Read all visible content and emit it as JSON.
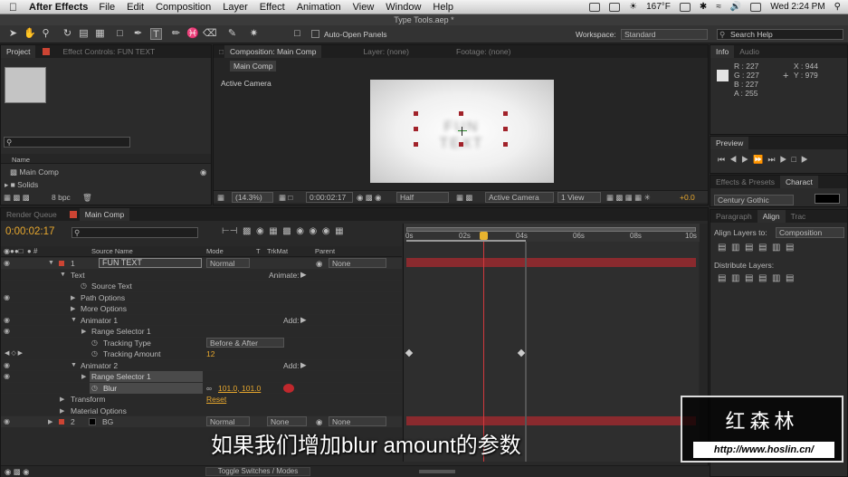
{
  "menubar": {
    "app": "After Effects",
    "items": [
      "File",
      "Edit",
      "Composition",
      "Layer",
      "Effect",
      "Animation",
      "View",
      "Window",
      "Help"
    ],
    "temp": "167°F",
    "time": "Wed 2:24 PM"
  },
  "window_title": "Type Tools.aep *",
  "toolbar": {
    "auto_open": "Auto-Open Panels",
    "workspace_label": "Workspace:",
    "workspace_value": "Standard",
    "search": "Search Help"
  },
  "project": {
    "tabs": [
      "Project",
      "Effect Controls: FUN TEXT"
    ],
    "col_name": "Name",
    "items": [
      "Main Comp",
      "Solids"
    ],
    "bpc": "8 bpc"
  },
  "comp": {
    "tabs": [
      "Composition: Main Comp",
      "Layer: (none)",
      "Footage: (none)"
    ],
    "subtab": "Main Comp",
    "camera": "Active Camera",
    "zoom": "(14.3%)",
    "timecode": "0:00:02:17",
    "resolution": "Half",
    "view_camera": "Active Camera",
    "views": "1 View",
    "exposure": "+0.0"
  },
  "info": {
    "tabs": [
      "Info",
      "Audio"
    ],
    "r": "R : 227",
    "g": "G : 227",
    "b": "B : 227",
    "a": "A : 255",
    "x": "X : 944",
    "y": "Y : 979"
  },
  "preview": {
    "tab": "Preview"
  },
  "effects": {
    "tabs": [
      "Effects & Presets",
      "Charact"
    ],
    "font": "Century Gothic"
  },
  "align": {
    "tabs": [
      "Paragraph",
      "Align",
      "Trac"
    ],
    "align_to": "Align Layers to:",
    "align_target": "Composition",
    "distribute": "Distribute Layers:"
  },
  "timeline": {
    "tabs": [
      "Render Queue",
      "Main Comp"
    ],
    "timecode": "0:00:02:17",
    "cols": {
      "source": "Source Name",
      "mode": "Mode",
      "t": "T",
      "trkmat": "TrkMat",
      "parent": "Parent"
    },
    "ruler": [
      "0s",
      "02s",
      "04s",
      "06s",
      "08s",
      "10s"
    ],
    "layers": [
      {
        "num": "1",
        "name": "FUN TEXT",
        "mode": "Normal",
        "parent": "None"
      },
      {
        "num": "2",
        "name": "BG",
        "mode": "Normal",
        "trkmat": "None",
        "parent": "None"
      }
    ],
    "props": {
      "text": "Text",
      "animate": "Animate:",
      "source_text": "Source Text",
      "path_options": "Path Options",
      "more_options": "More Options",
      "animator1": "Animator 1",
      "add": "Add:",
      "range1": "Range Selector 1",
      "tracking_type": "Tracking Type",
      "tracking_type_val": "Before & After",
      "tracking_amount": "Tracking Amount",
      "tracking_amount_val": "12",
      "animator2": "Animator 2",
      "range2": "Range Selector 1",
      "blur": "Blur",
      "blur_val": "101.0, 101.0",
      "transform": "Transform",
      "reset": "Reset",
      "material": "Material Options"
    },
    "toggle": "Toggle Switches / Modes"
  },
  "watermark": {
    "name": "红森林",
    "url": "http://www.hoslin.cn/"
  },
  "subtitle": "如果我们增加blur amount的参数"
}
